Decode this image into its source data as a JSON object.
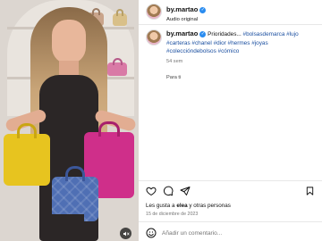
{
  "post": {
    "username": "by.martao",
    "audio": "Audio original",
    "caption_text": "Prioridades... ",
    "hashtags": "#bolsasdemarca #lujo #carteras #chanel #dior #hermes #joyas #coleccióndebolsos #cómico",
    "time_ago": "54 sem",
    "translate_label": "Para ti",
    "likes_prefix": "Les gusta a ",
    "likes_user": "elea",
    "likes_suffix": " y otras personas",
    "date": "15 de diciembre de 2023",
    "comment_placeholder": "Añadir un comentario..."
  },
  "icons": {
    "like": "heart-icon",
    "comment": "comment-icon",
    "share": "send-icon",
    "save": "bookmark-icon",
    "sound": "speaker-icon",
    "verified": "verified-badge-icon",
    "emoji": "emoji-icon"
  },
  "colors": {
    "verified": "#2a8cf0",
    "hashtag": "#1b4fa0"
  }
}
